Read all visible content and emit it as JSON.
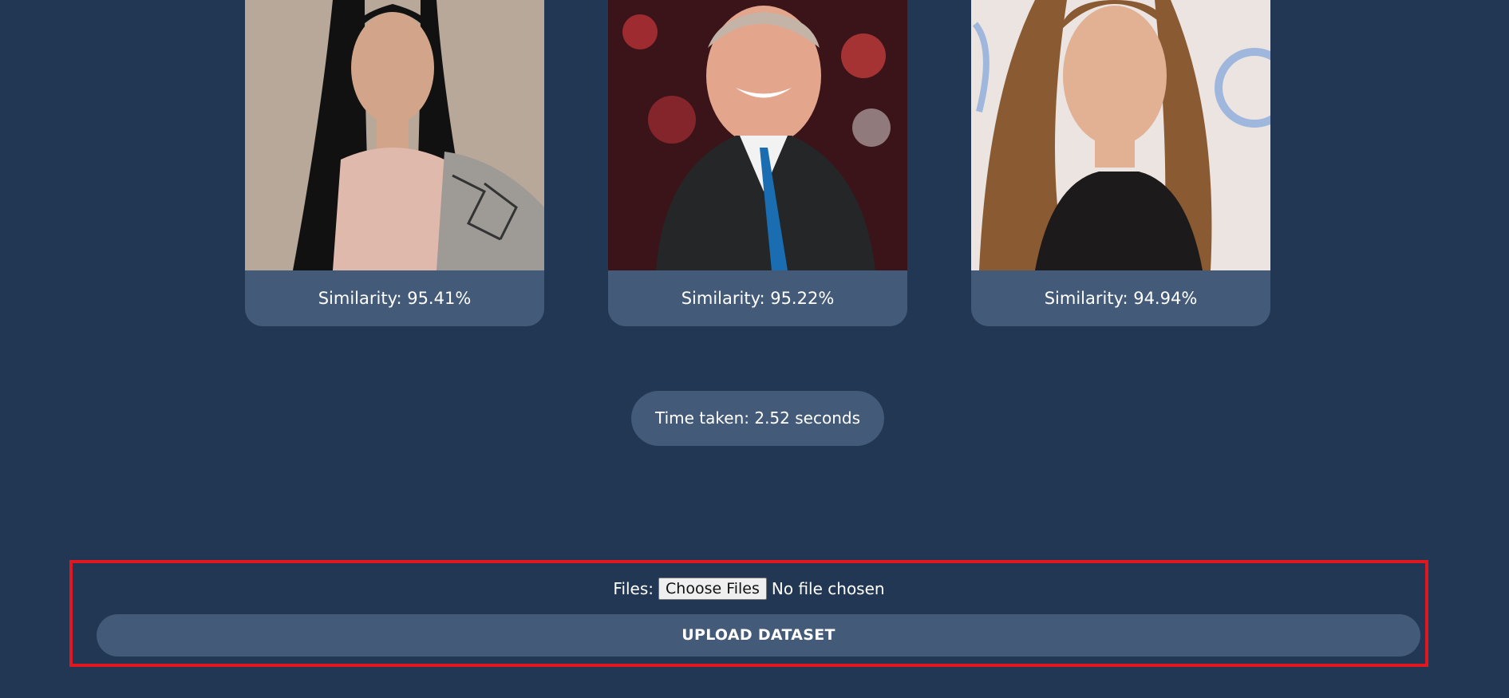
{
  "results": [
    {
      "similarity_text": "Similarity: 95.41%",
      "photo_icon": "person-photo"
    },
    {
      "similarity_text": "Similarity: 95.22%",
      "photo_icon": "person-photo"
    },
    {
      "similarity_text": "Similarity: 94.94%",
      "photo_icon": "person-photo"
    }
  ],
  "time_taken": "Time taken: 2.52 seconds",
  "upload_form": {
    "files_label": "Files:",
    "choose_button": "Choose Files",
    "file_status": "No file chosen",
    "submit_label": "UPLOAD DATASET"
  },
  "colors": {
    "background": "#223753",
    "card": "#435a78",
    "highlight_border": "#e0171f"
  }
}
